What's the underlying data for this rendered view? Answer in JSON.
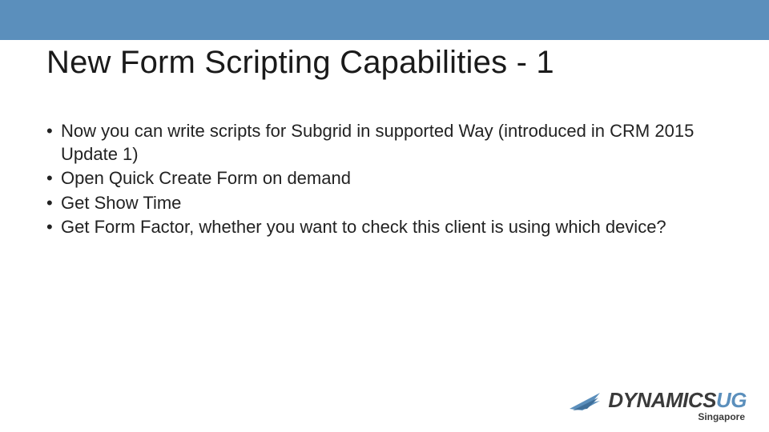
{
  "colors": {
    "band": "#5b8fbc",
    "logo_accent": "#5b8fbc",
    "text": "#222222"
  },
  "title": "New Form Scripting Capabilities - 1",
  "bullets": [
    "Now you can write scripts for Subgrid in supported Way (introduced in CRM 2015 Update 1)",
    "Open Quick Create Form on demand",
    "Get Show Time",
    "Get Form Factor, whether you want to check this client is using which device?"
  ],
  "logo": {
    "word_main": "DYNAMICS",
    "word_accent": "UG",
    "subtitle": "Singapore"
  }
}
